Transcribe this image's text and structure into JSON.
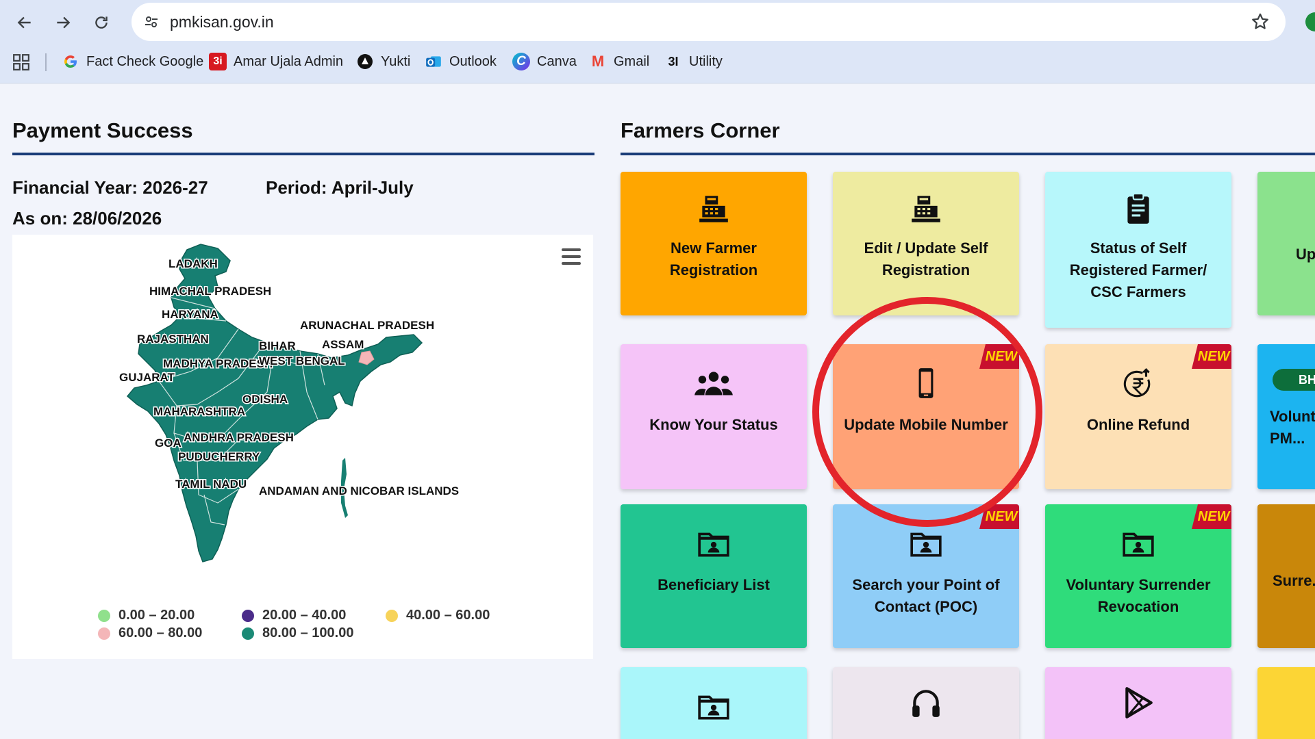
{
  "browser": {
    "url": "pmkisan.gov.in",
    "bookmarks": [
      {
        "label": "Fact Check Google",
        "icon": "google-icon"
      },
      {
        "label": "Amar Ujala Admin",
        "icon": "amar-ujala-icon",
        "badge": "3i"
      },
      {
        "label": "Yukti",
        "icon": "yukti-icon"
      },
      {
        "label": "Outlook",
        "icon": "outlook-icon"
      },
      {
        "label": "Canva",
        "icon": "canva-icon",
        "badge": "C"
      },
      {
        "label": "Gmail",
        "icon": "gmail-icon",
        "badge": "M"
      },
      {
        "label": "Utility",
        "icon": "utility-icon",
        "badge": "3I"
      }
    ]
  },
  "payment": {
    "title": "Payment Success",
    "financial_year": "Financial Year: 2026-27",
    "period": "Period: April-July",
    "as_on": "As on: 28/06/2026"
  },
  "map": {
    "states": [
      "LADAKH",
      "HIMACHAL PRADESH",
      "HARYANA",
      "RAJASTHAN",
      "ARUNACHAL PRADESH",
      "BIHAR",
      "ASSAM",
      "MADHYA PRADESH",
      "WEST BENGAL",
      "GUJARAT",
      "ODISHA",
      "MAHARASHTRA",
      "GOA",
      "ANDHRA PRADESH",
      "PUDUCHERRY",
      "TAMIL NADU",
      "ANDAMAN AND NICOBAR ISLANDS"
    ],
    "legend": [
      {
        "label": "0.00 – 20.00",
        "color": "#90e08c"
      },
      {
        "label": "20.00 – 40.00",
        "color": "#4b2c8a"
      },
      {
        "label": "40.00 – 60.00",
        "color": "#f7d35a"
      },
      {
        "label": "60.00 – 80.00",
        "color": "#f4b6b8"
      },
      {
        "label": "80.00 – 100.00",
        "color": "#1b8a76"
      }
    ]
  },
  "farmers_corner": {
    "title": "Farmers Corner",
    "tiles": [
      {
        "label": "New Farmer Registration",
        "color": "#ffa600",
        "icon": "register-icon"
      },
      {
        "label": "Edit / Update Self Registration",
        "color": "#eeeba0",
        "icon": "register-icon"
      },
      {
        "label": "Status of Self Registered Farmer/ CSC Farmers",
        "color": "#b7f7fb",
        "icon": "clipboard-icon"
      },
      {
        "label": "Up...",
        "color": "#8be28d",
        "icon": ""
      },
      {
        "label": "Know Your Status",
        "color": "#f5c4f8",
        "icon": "users-icon"
      },
      {
        "label": "Update Mobile Number",
        "color": "#ffa276",
        "icon": "mobile-icon",
        "badge": "NEW"
      },
      {
        "label": "Online Refund",
        "color": "#fde0b5",
        "icon": "rupee-refund-icon",
        "badge": "NEW"
      },
      {
        "label": "Volunt... PM...",
        "color": "#1cb4f0",
        "icon": ""
      },
      {
        "label": "Beneficiary List",
        "color": "#22c591",
        "icon": "folder-user-icon"
      },
      {
        "label": "Search your Point of Contact (POC)",
        "color": "#8fcdf7",
        "icon": "folder-user-icon",
        "badge": "NEW"
      },
      {
        "label": "Voluntary Surrender Revocation",
        "color": "#2fdc7b",
        "icon": "folder-user-icon",
        "badge": "NEW"
      },
      {
        "label": "Surre...",
        "color": "#c9870a",
        "icon": ""
      },
      {
        "label": "",
        "color": "#aaf6fa",
        "icon": "folder-user-icon"
      },
      {
        "label": "",
        "color": "#ede6ee",
        "icon": "headphones-icon"
      },
      {
        "label": "",
        "color": "#f3c2f8",
        "icon": "play-store-icon"
      },
      {
        "label": "",
        "color": "#fcd535",
        "icon": ""
      }
    ],
    "partial_badge": "BH"
  }
}
